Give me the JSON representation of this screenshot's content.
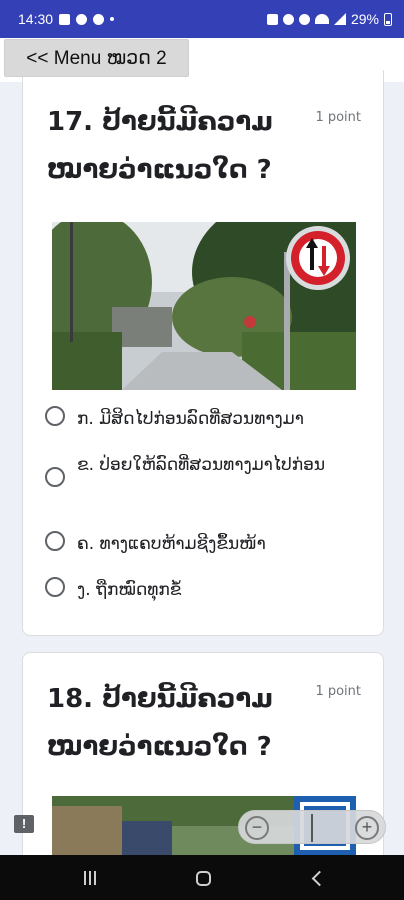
{
  "status_bar": {
    "time": "14:30",
    "battery_percent": "29%"
  },
  "header": {
    "menu_button_label": "<< Menu ໝວດ 2"
  },
  "questions": [
    {
      "title": "17. ປ້າຍນີ້ມີຄວາມໝາຍວ່າແນວໃດ ?",
      "points": "1 point",
      "image_alt": "traffic-sign-photo-priority-oncoming",
      "options": [
        "ກ. ມີສິດໄປກ່ອນລົດທີ່ສວນທາງມາ",
        "ຂ. ປ່ອຍໃຫ້ລົດທີ່ສວນທາງມາໄປກ່ອນ",
        "ຄ. ທາງແຄບຫ້າມຊີງຂຶ້ນໜ້າ",
        "ງ. ຖືກໝົດທຸກຂໍ້"
      ]
    },
    {
      "title": "18. ປ້າຍນີ້ມີຄວາມໝາຍວ່າແນວໃດ ?",
      "points": "1 point",
      "image_alt": "traffic-sign-photo-2"
    }
  ],
  "controls": {
    "zoom_out_glyph": "−",
    "zoom_in_glyph": "+",
    "feedback_glyph": "!"
  },
  "colors": {
    "status_bar": "#3340b6",
    "page_background": "#eef0f7",
    "sign_red": "#d3202a"
  }
}
